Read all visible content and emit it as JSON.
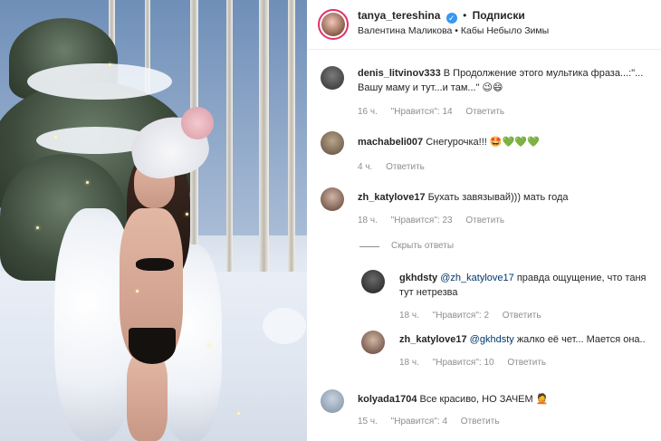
{
  "post": {
    "author": "tanya_tereshina",
    "dot": "•",
    "follow_label": "Подписки",
    "audio": "Валентина Маликова • Кабы Небыло Зимы"
  },
  "comments": [
    {
      "username": "denis_litvinov333",
      "line1": "В Продолжение этого мультика фраза...:\"...",
      "line2": "Вашу маму и тут...и там...\"",
      "emoji": "😉😄",
      "time": "16 ч.",
      "likes": "\"Нравится\": 14",
      "reply": "Ответить"
    },
    {
      "username": "machabeli007",
      "text": "Снегурочка!!!",
      "emoji": "🤩💚💚💚",
      "time": "4 ч.",
      "reply": "Ответить"
    },
    {
      "username": "zh_katylove17",
      "text": "Бухать завязывай))) мать года",
      "time": "18 ч.",
      "likes": "\"Нравится\": 23",
      "reply": "Ответить",
      "hide_replies": "Скрыть ответы",
      "replies": [
        {
          "username": "gkhdsty",
          "mention": "@zh_katylove17",
          "line1": "правда ощущение, что таня",
          "line2": "тут нетрезва",
          "time": "18 ч.",
          "likes": "\"Нравится\": 2",
          "reply": "Ответить"
        },
        {
          "username": "zh_katylove17",
          "mention": "@gkhdsty",
          "text": "жалко её чет... Мается она..",
          "time": "18 ч.",
          "likes": "\"Нравится\": 10",
          "reply": "Ответить"
        }
      ]
    },
    {
      "username": "kolyada1704",
      "text": "Все красиво, НО ЗАЧЕМ",
      "emoji": "🤦",
      "time": "15 ч.",
      "likes": "\"Нравится\": 4",
      "reply": "Ответить"
    }
  ],
  "colors": {
    "accent": "#3897f0",
    "mention": "#00376b",
    "meta": "#8e8e8e",
    "text": "#262626"
  },
  "icons": {
    "verified": "verified-badge-icon",
    "audio": "music-note-icon"
  }
}
